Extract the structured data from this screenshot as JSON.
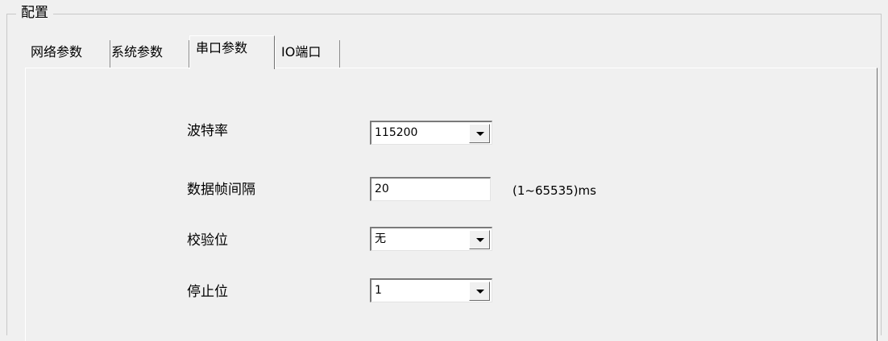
{
  "group": {
    "title": "配置"
  },
  "tabs": [
    {
      "label": "网络参数",
      "active": false
    },
    {
      "label": "系统参数",
      "active": false
    },
    {
      "label": "串口参数",
      "active": true
    },
    {
      "label": "IO端口",
      "active": false
    }
  ],
  "fields": {
    "baud_rate": {
      "label": "波特率",
      "value": "115200"
    },
    "frame_interval": {
      "label": "数据帧间隔",
      "value": "20",
      "hint": "(1~65535)ms"
    },
    "parity": {
      "label": "校验位",
      "value": "无"
    },
    "stop_bits": {
      "label": "停止位",
      "value": "1"
    }
  },
  "icons": {
    "dropdown": "chevron-down-icon"
  }
}
